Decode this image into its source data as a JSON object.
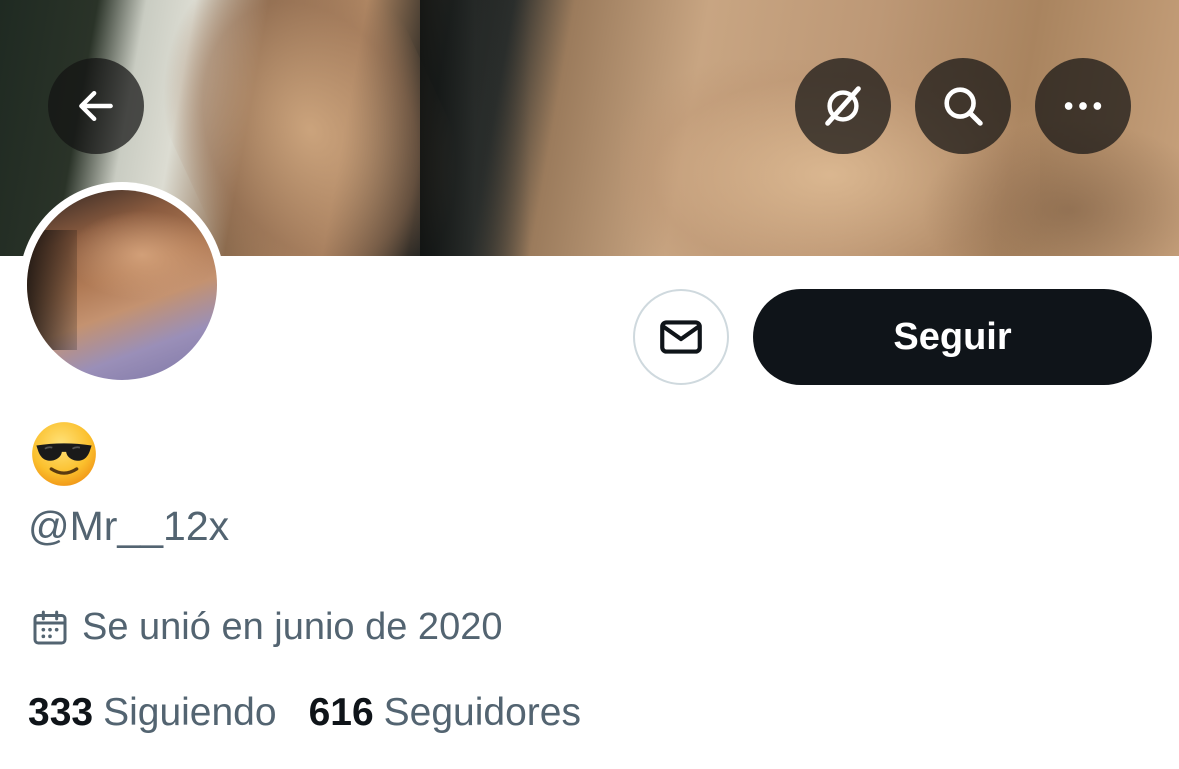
{
  "header": {
    "back_icon": "arrow-left-icon",
    "grok_icon": "grok-icon",
    "search_icon": "search-icon",
    "more_icon": "more-horizontal-icon"
  },
  "profile": {
    "display_name_emoji": "😎",
    "handle": "@Mr__12x",
    "joined_text": "Se unió en junio de 2020",
    "joined_icon": "calendar-icon"
  },
  "actions": {
    "message_icon": "mail-icon",
    "follow_label": "Seguir"
  },
  "stats": {
    "following_count": "333",
    "following_label": "Siguiendo",
    "followers_count": "616",
    "followers_label": "Seguidores"
  },
  "colors": {
    "primary_text": "#0f1419",
    "secondary_text": "#536471",
    "follow_button_bg": "#0f1419",
    "border": "#cfd9de"
  }
}
